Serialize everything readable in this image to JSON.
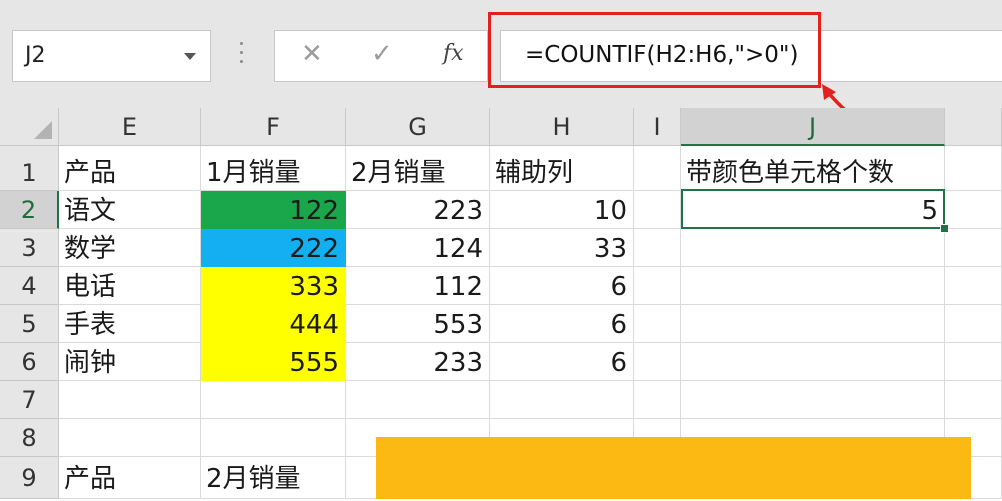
{
  "name_box": {
    "value": "J2"
  },
  "formula_bar": {
    "cancel_glyph": "✕",
    "enter_glyph": "✓",
    "fx_label": "fx",
    "formula": "=COUNTIF(H2:H6,\">0\")"
  },
  "columns": [
    "E",
    "F",
    "G",
    "H",
    "I",
    "J"
  ],
  "rows": [
    "1",
    "2",
    "3",
    "4",
    "5",
    "6",
    "7",
    "8",
    "9"
  ],
  "cells": {
    "E1": "产品",
    "F1": "1月销量",
    "G1": "2月销量",
    "H1": "辅助列",
    "J1": "带颜色单元格个数",
    "E2": "语文",
    "F2": "122",
    "G2": "223",
    "H2": "10",
    "J2": "5",
    "E3": "数学",
    "F3": "222",
    "G3": "124",
    "H3": "33",
    "E4": "电话",
    "F4": "333",
    "G4": "112",
    "H4": "6",
    "E5": "手表",
    "F5": "444",
    "G5": "553",
    "H5": "6",
    "E6": "闹钟",
    "F6": "555",
    "G6": "233",
    "H6": "6",
    "E9": "产品",
    "F9": "2月销量"
  },
  "cell_fills": {
    "F2": "#1aa64a",
    "F3": "#13aff0",
    "F4": "#ffff00",
    "F5": "#ffff00",
    "F6": "#ffff00"
  },
  "selection": {
    "active_cell": "J2",
    "active_column": "J",
    "active_row": "2"
  },
  "annotation": {
    "highlight_color": "#e3201b",
    "overlay_color": "#fdb913"
  },
  "overlay": {
    "text": ""
  }
}
